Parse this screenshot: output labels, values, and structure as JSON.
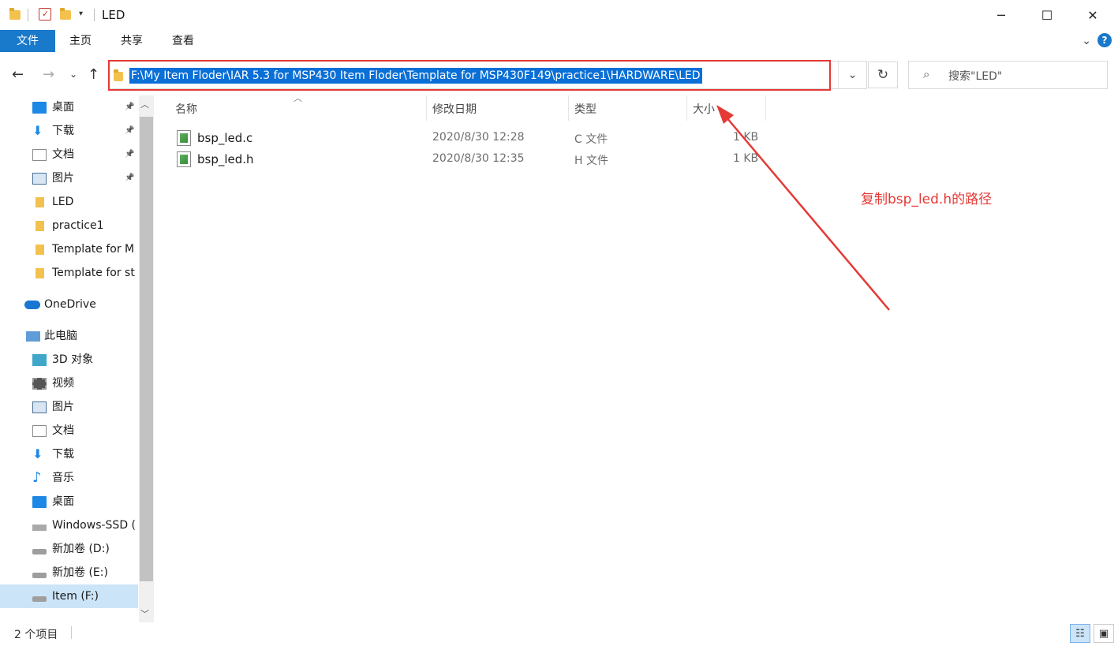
{
  "window": {
    "title": "LED",
    "minimize": "─",
    "maximize": "☐",
    "close": "✕"
  },
  "ribbon": {
    "tabs": [
      "文件",
      "主页",
      "共享",
      "查看"
    ]
  },
  "nav": {
    "address": "F:\\My Item Floder\\IAR 5.3 for MSP430 Item Floder\\Template for MSP430F149\\practice1\\HARDWARE\\LED",
    "search_placeholder": "搜索\"LED\""
  },
  "sidebar": {
    "items": [
      {
        "label": "桌面",
        "icon": "desktop-icon",
        "pinned": true
      },
      {
        "label": "下载",
        "icon": "download-icon",
        "pinned": true
      },
      {
        "label": "文档",
        "icon": "document-icon",
        "pinned": true
      },
      {
        "label": "图片",
        "icon": "picture-icon",
        "pinned": true
      },
      {
        "label": "LED",
        "icon": "folder-icon",
        "pinned": false
      },
      {
        "label": "practice1",
        "icon": "folder-icon",
        "pinned": false
      },
      {
        "label": "Template for M",
        "icon": "folder-icon",
        "pinned": false
      },
      {
        "label": "Template for st",
        "icon": "folder-icon",
        "pinned": false
      },
      {
        "label": "OneDrive",
        "icon": "onedrive-icon",
        "pinned": false
      },
      {
        "label": "此电脑",
        "icon": "this-pc-icon",
        "pinned": false
      },
      {
        "label": "3D 对象",
        "icon": "3d-objects-icon",
        "pinned": false
      },
      {
        "label": "视频",
        "icon": "video-icon",
        "pinned": false
      },
      {
        "label": "图片",
        "icon": "picture-icon",
        "pinned": false
      },
      {
        "label": "文档",
        "icon": "document-icon",
        "pinned": false
      },
      {
        "label": "下载",
        "icon": "download-icon",
        "pinned": false
      },
      {
        "label": "音乐",
        "icon": "music-icon",
        "pinned": false
      },
      {
        "label": "桌面",
        "icon": "desktop-icon",
        "pinned": false
      },
      {
        "label": "Windows-SSD (",
        "icon": "windows-drive-icon",
        "pinned": false
      },
      {
        "label": "新加卷 (D:)",
        "icon": "drive-icon",
        "pinned": false
      },
      {
        "label": "新加卷 (E:)",
        "icon": "drive-icon",
        "pinned": false
      },
      {
        "label": "Item (F:)",
        "icon": "drive-icon",
        "pinned": false,
        "selected": true
      }
    ]
  },
  "columns": {
    "name": "名称",
    "date": "修改日期",
    "type": "类型",
    "size": "大小"
  },
  "files": [
    {
      "name": "bsp_led.c",
      "date": "2020/8/30 12:28",
      "type": "C 文件",
      "size": "1 KB"
    },
    {
      "name": "bsp_led.h",
      "date": "2020/8/30 12:35",
      "type": "H 文件",
      "size": "1 KB"
    }
  ],
  "annotation": "复制bsp_led.h的路径",
  "status": {
    "count": "2 个项目"
  },
  "colors": {
    "accent": "#1979ca",
    "selection": "#0a6fd6",
    "annotation_red": "#e53935"
  }
}
